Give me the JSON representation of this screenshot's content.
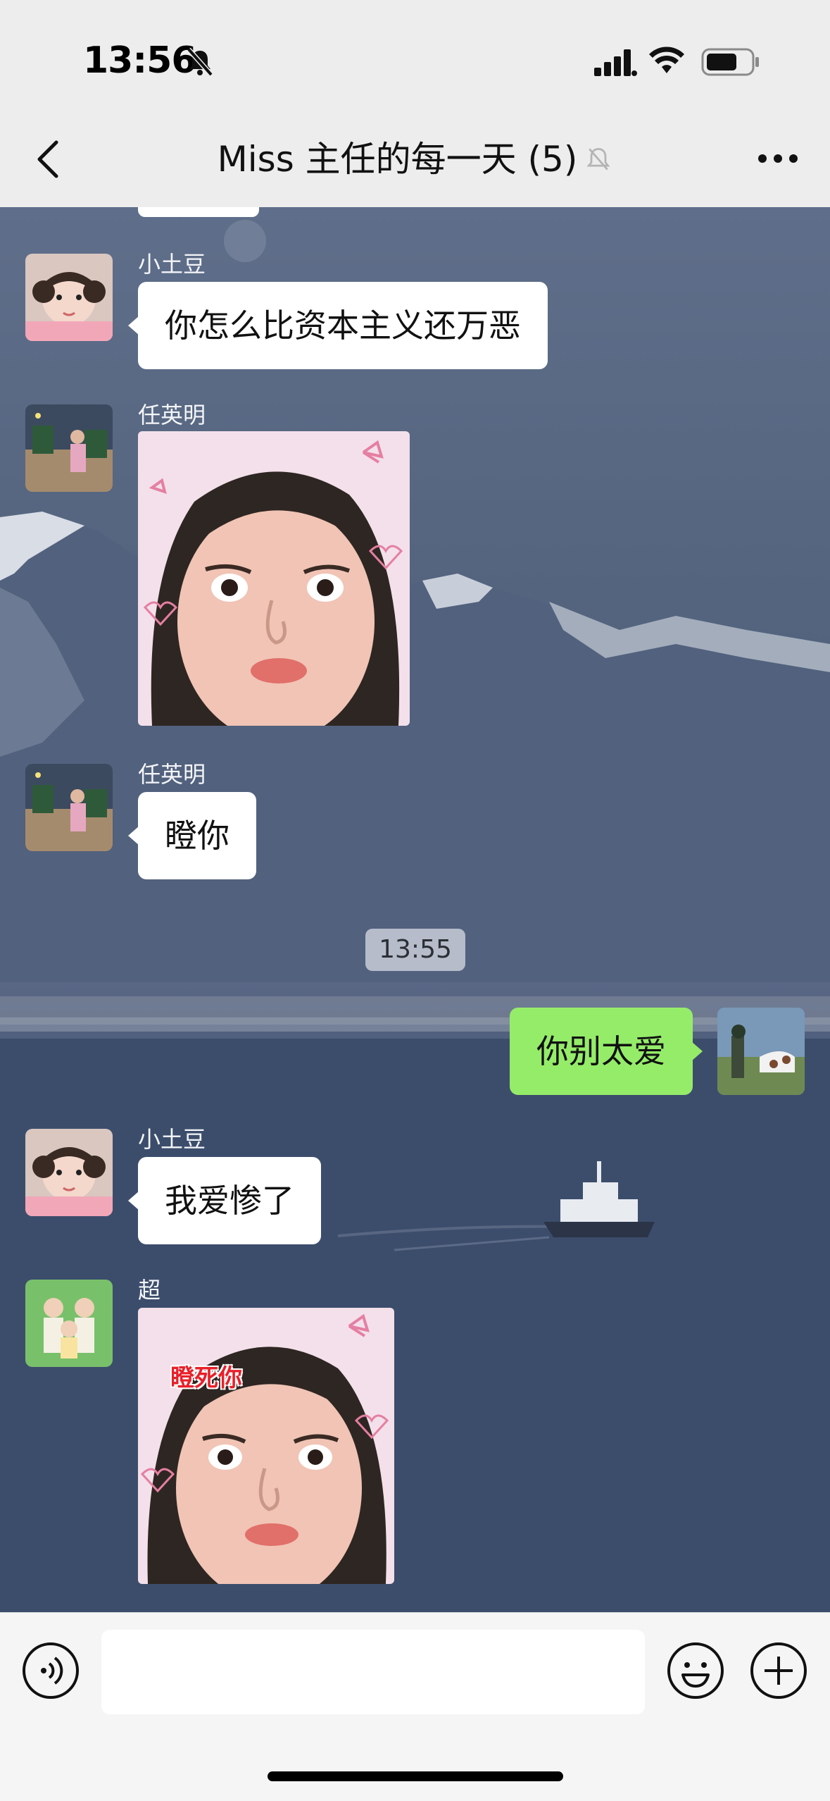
{
  "status_bar": {
    "time": "13:56",
    "icons": [
      "bell-slash-icon",
      "cellular-signal-icon",
      "wifi-icon",
      "battery-icon"
    ]
  },
  "nav": {
    "back_icon": "chevron-left-icon",
    "title": "Miss 主任的每一天 (5)",
    "muted_icon": "bell-slash-icon",
    "more_icon": "ellipsis-icon"
  },
  "messages": [
    {
      "sender": "小土豆",
      "type": "text",
      "text": "你怎么比资本主义还万恶"
    },
    {
      "sender": "任英明",
      "type": "sticker",
      "sticker": "staring-face-sticker"
    },
    {
      "sender": "任英明",
      "type": "text",
      "text": "瞪你"
    },
    {
      "type": "time",
      "text": "13:55"
    },
    {
      "sender": "me",
      "type": "text",
      "text": "你别太爱"
    },
    {
      "sender": "小土豆",
      "type": "text",
      "text": "我爱惨了"
    },
    {
      "sender": "超",
      "type": "sticker",
      "sticker": "staring-face-sticker",
      "caption": "瞪死你"
    }
  ],
  "input_bar": {
    "voice_icon": "voice-icon",
    "input_value": "",
    "emoji_icon": "emoji-icon",
    "plus_icon": "plus-icon"
  },
  "colors": {
    "own_bubble": "#95ec69",
    "other_bubble": "#ffffff",
    "header_bg": "#ededed"
  }
}
